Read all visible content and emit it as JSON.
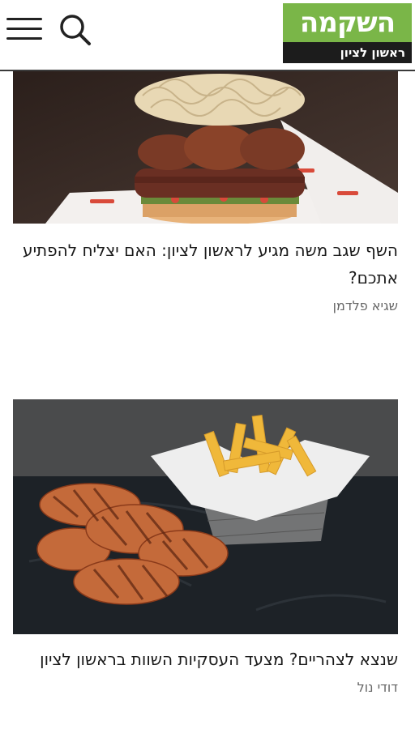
{
  "header": {
    "menu_icon": "hamburger-menu-icon",
    "search_icon": "search-icon",
    "logo": {
      "title": "השקמה",
      "subtitle": "ראשון לציון"
    },
    "colors": {
      "logo_green": "#7ab648",
      "logo_dark": "#1c1c1c"
    }
  },
  "articles": [
    {
      "image": "burger-photo",
      "title": "השף שגב משה מגיע לראשון לציון: האם יצליח להפתיע אתכם?",
      "author": "שגיא פלדמן"
    },
    {
      "image": "grilled-chicken-and-fries-photo",
      "title": "שנצא לצהריים? מצעד העסקיות השוות בראשון לציון",
      "author": "דודי נול"
    }
  ]
}
